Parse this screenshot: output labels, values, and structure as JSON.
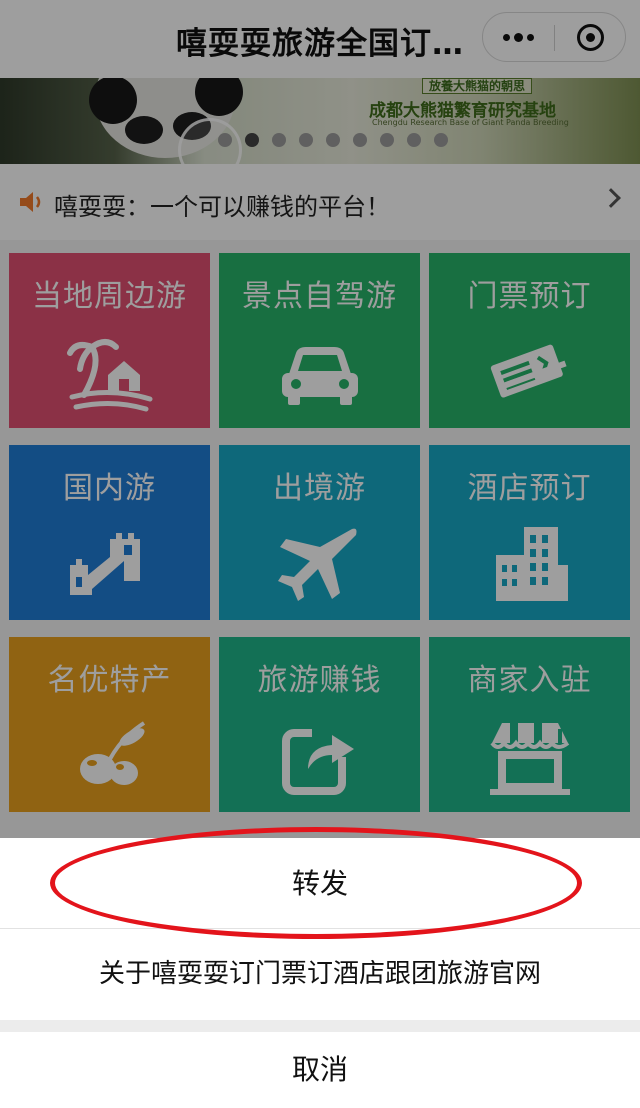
{
  "nav": {
    "title": "嘻耍耍旅游全国订…",
    "more_icon": "more-dots-icon",
    "close_icon": "miniprogram-close-icon"
  },
  "banner": {
    "tag": "放養大熊猫的朝思",
    "title_cn": "成都大熊猫繁育研究基地",
    "title_en": "Chengdu Research Base of Giant Panda Breeding",
    "slide_count": 9,
    "active_slide": 1
  },
  "notice": {
    "icon": "speaker-icon",
    "text": "嘻耍耍：一个可以赚钱的平台！",
    "chevron_icon": "chevron-right-icon"
  },
  "tiles": [
    {
      "label": "当地周边游",
      "icon": "island-house-icon",
      "color": "#e04f71"
    },
    {
      "label": "景点自驾游",
      "icon": "car-icon",
      "color": "#27b36a"
    },
    {
      "label": "门票预订",
      "icon": "ticket-icon",
      "color": "#27b36a"
    },
    {
      "label": "国内游",
      "icon": "great-wall-icon",
      "color": "#1f7dd6"
    },
    {
      "label": "出境游",
      "icon": "airplane-icon",
      "color": "#17a8c6"
    },
    {
      "label": "酒店预订",
      "icon": "hotel-building-icon",
      "color": "#17a8c6"
    },
    {
      "label": "名优特产",
      "icon": "olive-icon",
      "color": "#e8a11d"
    },
    {
      "label": "旅游赚钱",
      "icon": "share-icon",
      "color": "#20b58a"
    },
    {
      "label": "商家入驻",
      "icon": "storefront-icon",
      "color": "#20b58a"
    }
  ],
  "action_sheet": {
    "forward": "转发",
    "about": "关于嘻耍耍订门票订酒店跟团旅游官网",
    "cancel": "取消"
  },
  "colors": {
    "annotation": "#e3141b",
    "mask": "rgba(0,0,0,0.38)"
  }
}
